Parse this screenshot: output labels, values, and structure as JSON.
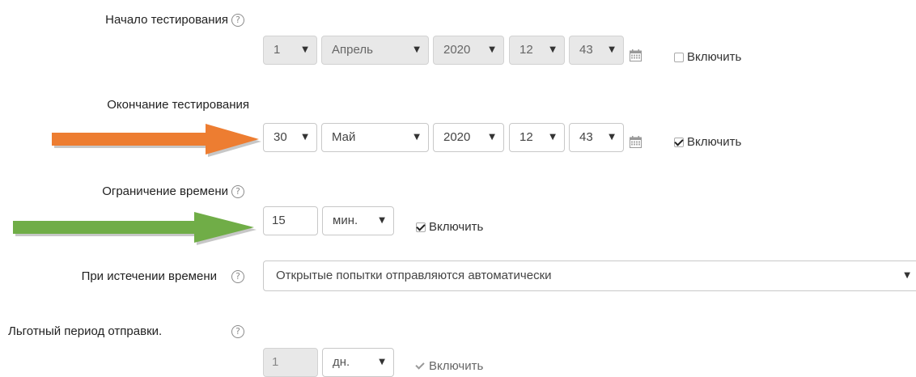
{
  "colors": {
    "orange_arrow": "#ed7d31",
    "green_arrow": "#70ad47"
  },
  "start": {
    "label": "Начало тестирования",
    "day": "1",
    "month": "Апрель",
    "year": "2020",
    "hour": "12",
    "minute": "43",
    "enable_label": "Включить",
    "enabled": false
  },
  "end": {
    "label": "Окончание тестирования",
    "day": "30",
    "month": "Май",
    "year": "2020",
    "hour": "12",
    "minute": "43",
    "enable_label": "Включить",
    "enabled": true
  },
  "time_limit": {
    "label": "Ограничение времени",
    "value": "15",
    "unit": "мин.",
    "enable_label": "Включить",
    "enabled": true
  },
  "on_expiry": {
    "label": "При истечении времени",
    "value": "Открытые попытки отправляются автоматически"
  },
  "grace": {
    "label": "Льготный период отправки.",
    "value": "1",
    "unit": "дн.",
    "enable_label": "Включить",
    "enabled": true
  },
  "icons": {
    "help": "question-circle-icon",
    "calendar": "calendar-icon",
    "dropdown": "caret-down-icon"
  }
}
